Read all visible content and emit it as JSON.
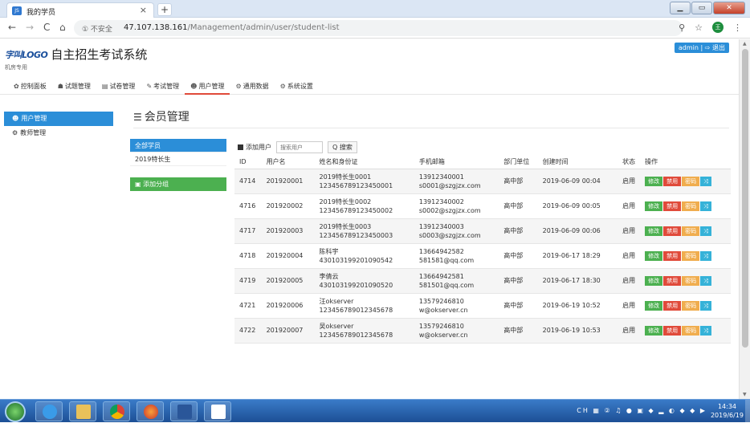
{
  "browser": {
    "tab_title": "我的学员",
    "tab_favicon": "JS",
    "url_security": "① 不安全",
    "url_host": "47.107.138.161",
    "url_path": "/Management/admin/user/student-list"
  },
  "header": {
    "logo_text": "字叫LOGO",
    "title": "自主招生考试系统",
    "subtitle": "机房专用",
    "admin_label": "admin | ⇨ 退出"
  },
  "menu": [
    {
      "icon": "✿",
      "label": "控制面板"
    },
    {
      "icon": "☗",
      "label": "试题管理"
    },
    {
      "icon": "▤",
      "label": "试卷管理"
    },
    {
      "icon": "✎",
      "label": "考试管理"
    },
    {
      "icon": "☻",
      "label": "用户管理"
    },
    {
      "icon": "⚙",
      "label": "通用数据"
    },
    {
      "icon": "⚙",
      "label": "系统设置"
    }
  ],
  "sidebar": [
    {
      "label": "用户管理"
    },
    {
      "label": "教师管理"
    }
  ],
  "content": {
    "title": "会员管理",
    "groups": [
      "全部学员",
      "2019特长生"
    ],
    "add_group": "添加分组",
    "add_user": "添加用户",
    "search_placeholder": "搜索用户",
    "search_button": "Q 搜索"
  },
  "table": {
    "headers": [
      "ID",
      "用户名",
      "姓名和身份证",
      "手机邮箱",
      "部门单位",
      "创建时间",
      "状态",
      "操作"
    ],
    "rows": [
      {
        "id": "4714",
        "username": "201920001",
        "name": "2019特长生0001",
        "idcard": "123456789123450001",
        "phone": "13912340001",
        "email": "s0001@szgjzx.com",
        "dept": "高中部",
        "created": "2019-06-09 00:04",
        "status": "启用"
      },
      {
        "id": "4716",
        "username": "201920002",
        "name": "2019特长生0002",
        "idcard": "123456789123450002",
        "phone": "13912340002",
        "email": "s0002@szgjzx.com",
        "dept": "高中部",
        "created": "2019-06-09 00:05",
        "status": "启用"
      },
      {
        "id": "4717",
        "username": "201920003",
        "name": "2019特长生0003",
        "idcard": "123456789123450003",
        "phone": "13912340003",
        "email": "s0003@szgjzx.com",
        "dept": "高中部",
        "created": "2019-06-09 00:06",
        "status": "启用"
      },
      {
        "id": "4718",
        "username": "201920004",
        "name": "陈科宇",
        "idcard": "430103199201090542",
        "phone": "13664942582",
        "email": "581581@qq.com",
        "dept": "高中部",
        "created": "2019-06-17 18:29",
        "status": "启用"
      },
      {
        "id": "4719",
        "username": "201920005",
        "name": "李倩云",
        "idcard": "430103199201090520",
        "phone": "13664942581",
        "email": "581501@qq.com",
        "dept": "高中部",
        "created": "2019-06-17 18:30",
        "status": "启用"
      },
      {
        "id": "4721",
        "username": "201920006",
        "name": "汪okserver",
        "idcard": "123456789012345678",
        "phone": "13579246810",
        "email": "w@okserver.cn",
        "dept": "高中部",
        "created": "2019-06-19 10:52",
        "status": "启用"
      },
      {
        "id": "4722",
        "username": "201920007",
        "name": "吴okserver",
        "idcard": "123456789012345678",
        "phone": "13579246810",
        "email": "w@okserver.cn",
        "dept": "高中部",
        "created": "2019-06-19 10:53",
        "status": "启用"
      }
    ],
    "ops": {
      "edit": "修改",
      "ban": "禁用",
      "pwd": "密码",
      "move": "⤨"
    }
  },
  "taskbar": {
    "time": "14:34",
    "date": "2019/6/19",
    "tray": "CH ▦ ② ♫ ● ▣ ◆ ▂ ◐ ◆ ◆ ▶"
  },
  "colors": {
    "primary": "#2b8ed8",
    "green": "#4cb050",
    "red": "#e04a3a",
    "orange": "#f0ad4e",
    "cyan": "#35b2d8"
  }
}
